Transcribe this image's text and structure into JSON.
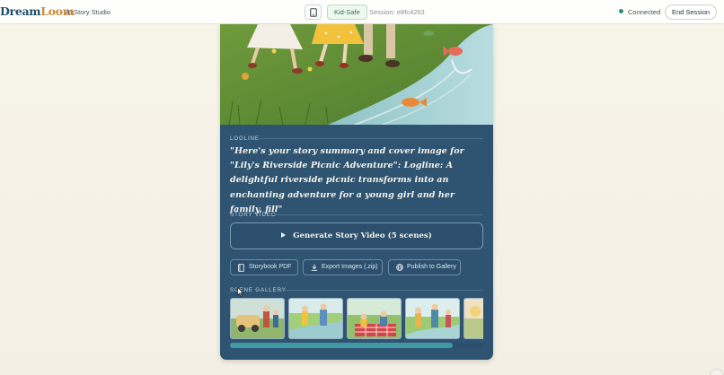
{
  "header": {
    "brand_part1": "Dream",
    "brand_part2": "Loom",
    "subtitle": "AI Story Studio",
    "kid_safe_label": "Kid-Safe",
    "session_label": "Session: e8fc4263",
    "status_label": "Connected",
    "end_session_label": "End Session",
    "status_color": "#2f8a7a"
  },
  "card": {
    "cover_alt_icon": "cover-illustration",
    "logline_label": "LOGLINE",
    "logline_text": "\"Here's your story summary and cover image for \"Lily's Riverside Picnic Adventure\": Logline: A delightful riverside picnic transforms into an enchanting adventure for a young girl and her family, fill\"",
    "story_video_label": "STORY VIDEO",
    "generate_video_label": "Generate Story Video (5 scenes)",
    "storybook_pdf_label": "Storybook PDF",
    "export_images_label": "Export Images (.zip)",
    "publish_label": "Publish to Gallery",
    "scene_gallery_label": "SCENE GALLERY",
    "gallery_scroll_fraction": 0.88
  },
  "colors": {
    "card_bg": "#2e5472",
    "accent": "#3e9aa0",
    "brand_dark": "#1e4e66",
    "brand_gold": "#c98a3a"
  }
}
